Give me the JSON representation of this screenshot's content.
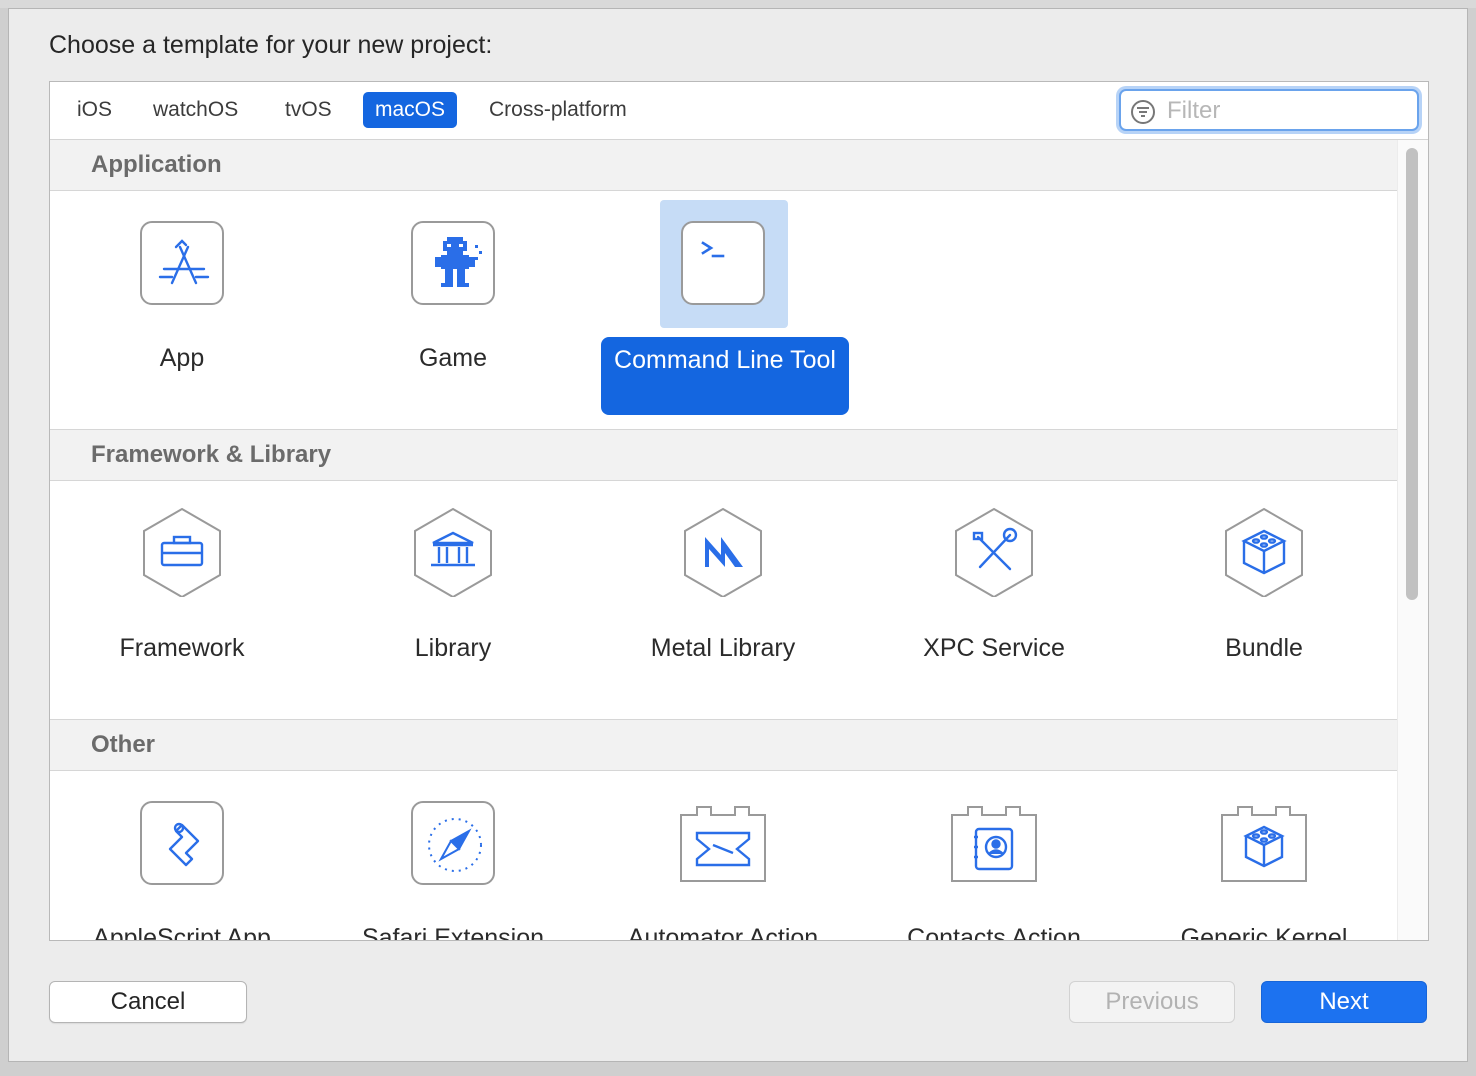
{
  "dialog": {
    "prompt": "Choose a template for your new project:"
  },
  "tabs": [
    {
      "label": "iOS",
      "selected": false
    },
    {
      "label": "watchOS",
      "selected": false
    },
    {
      "label": "tvOS",
      "selected": false
    },
    {
      "label": "macOS",
      "selected": true
    },
    {
      "label": "Cross-platform",
      "selected": false
    }
  ],
  "filter": {
    "placeholder": "Filter",
    "value": ""
  },
  "sections": [
    {
      "title": "Application",
      "items": [
        {
          "label": "App",
          "icon": "app-store-icon"
        },
        {
          "label": "Game",
          "icon": "game-character-icon"
        },
        {
          "label": "Command Line Tool",
          "icon": "terminal-icon",
          "selected": true
        }
      ]
    },
    {
      "title": "Framework & Library",
      "items": [
        {
          "label": "Framework",
          "icon": "toolbox-icon"
        },
        {
          "label": "Library",
          "icon": "library-building-icon"
        },
        {
          "label": "Metal Library",
          "icon": "metal-icon"
        },
        {
          "label": "XPC Service",
          "icon": "tools-icon"
        },
        {
          "label": "Bundle",
          "icon": "lego-brick-icon"
        }
      ]
    },
    {
      "title": "Other",
      "items": [
        {
          "label": "AppleScript App",
          "icon": "script-scroll-icon"
        },
        {
          "label": "Safari Extension",
          "icon": "compass-icon"
        },
        {
          "label": "Automator Action",
          "icon": "automator-icon"
        },
        {
          "label": "Contacts Action",
          "icon": "contacts-icon"
        },
        {
          "label": "Generic Kernel Extension",
          "icon": "kernel-brick-icon"
        }
      ]
    }
  ],
  "buttons": {
    "cancel": "Cancel",
    "previous": "Previous",
    "next": "Next"
  },
  "colors": {
    "accent": "#1466e0",
    "selection_tile": "#c6dcf6",
    "icon_stroke": "#2a6ee8"
  }
}
